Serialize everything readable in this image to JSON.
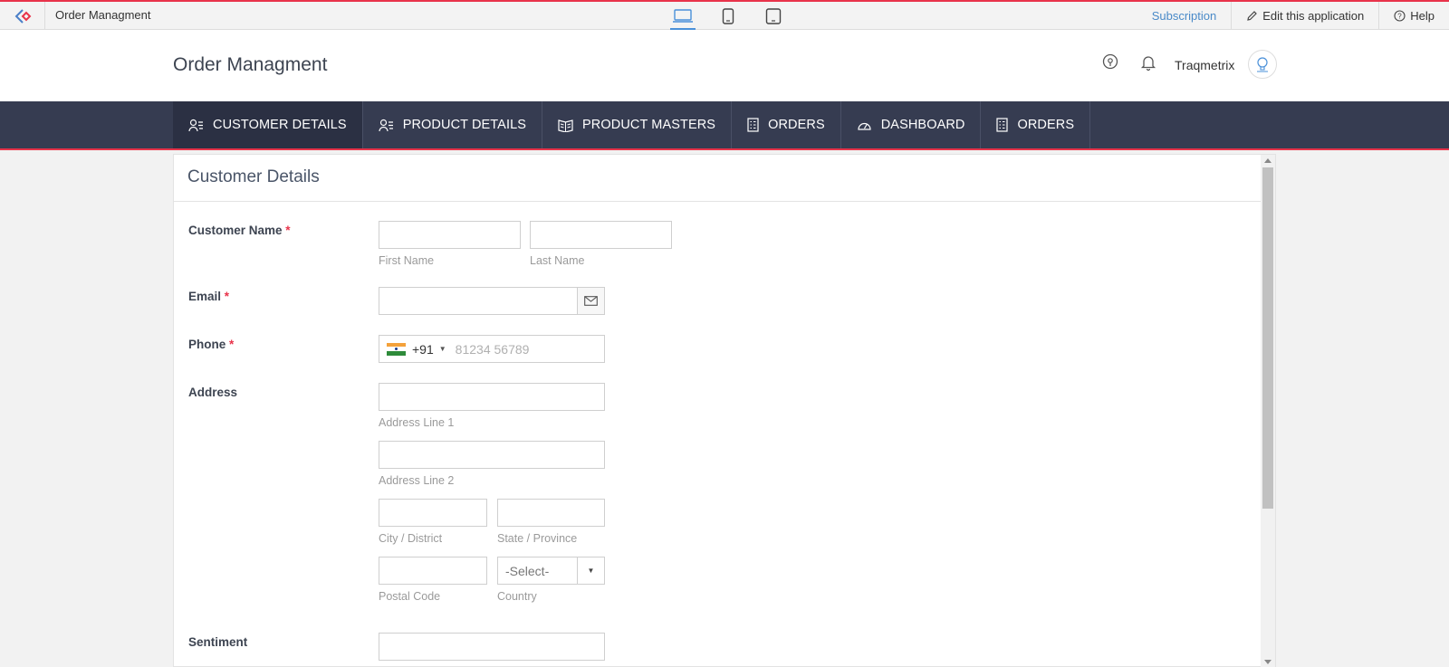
{
  "topbar": {
    "title": "Order Managment",
    "subscription": "Subscription",
    "edit": "Edit this application",
    "help": "Help"
  },
  "header": {
    "app_title": "Order Managment",
    "user": "Traqmetrix"
  },
  "nav": {
    "tabs": [
      {
        "label": "CUSTOMER DETAILS",
        "icon": "user-list-icon"
      },
      {
        "label": "PRODUCT DETAILS",
        "icon": "user-list-icon"
      },
      {
        "label": "PRODUCT MASTERS",
        "icon": "book-icon"
      },
      {
        "label": "ORDERS",
        "icon": "report-icon"
      },
      {
        "label": "DASHBOARD",
        "icon": "gauge-icon"
      },
      {
        "label": "ORDERS",
        "icon": "report-icon"
      }
    ]
  },
  "form": {
    "title": "Customer Details",
    "customer_name_label": "Customer Name",
    "first_name_hint": "First Name",
    "last_name_hint": "Last Name",
    "email_label": "Email",
    "phone_label": "Phone",
    "phone_code": "+91",
    "phone_placeholder": "81234 56789",
    "address_label": "Address",
    "address1_hint": "Address Line 1",
    "address2_hint": "Address Line 2",
    "city_hint": "City / District",
    "state_hint": "State / Province",
    "postal_hint": "Postal Code",
    "country_hint": "Country",
    "country_value": "-Select-",
    "sentiment_label": "Sentiment",
    "required_mark": "*"
  },
  "colors": {
    "accent": "#e8334a",
    "nav_bg": "#363c51",
    "link": "#4a8ac8"
  }
}
